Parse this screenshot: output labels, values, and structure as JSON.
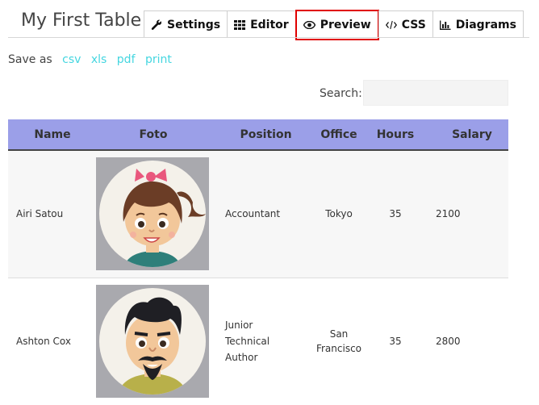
{
  "title": "My First Table",
  "tabs": [
    {
      "label": "Settings",
      "icon": "wrench-icon"
    },
    {
      "label": "Editor",
      "icon": "grid-icon"
    },
    {
      "label": "Preview",
      "icon": "eye-icon"
    },
    {
      "label": "CSS",
      "icon": "code-icon"
    },
    {
      "label": "Diagrams",
      "icon": "bar-chart-icon"
    }
  ],
  "save_as": {
    "label": "Save as",
    "options": [
      "csv",
      "xls",
      "pdf",
      "print"
    ]
  },
  "search": {
    "label": "Search:",
    "placeholder": ""
  },
  "table": {
    "columns": [
      "Name",
      "Foto",
      "Position",
      "Office",
      "Hours",
      "Salary"
    ],
    "rows": [
      {
        "name": "Airi Satou",
        "photo": "girl-avatar",
        "position_lines": [
          "Accountant"
        ],
        "office_lines": [
          "Tokyo"
        ],
        "hours": "35",
        "salary": "2100"
      },
      {
        "name": "Ashton Cox",
        "photo": "boy-avatar",
        "position_lines": [
          "Junior",
          "Technical",
          "Author"
        ],
        "office_lines": [
          "San",
          "Francisco"
        ],
        "hours": "35",
        "salary": "2800"
      }
    ]
  },
  "colors": {
    "header_bg": "#9b9fe8",
    "link": "#45d6e0",
    "active_tab_border": "#e00000"
  }
}
